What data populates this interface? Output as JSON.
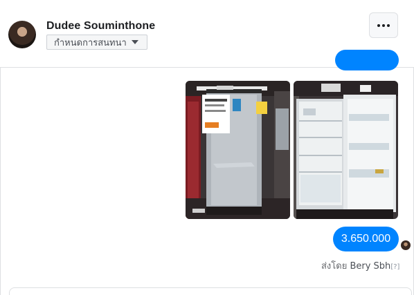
{
  "header": {
    "name": "Dudee Souminthone",
    "nickname_button": "กำหนดการสนทนา"
  },
  "messages": {
    "last_text": "3.650.000",
    "sent_by_prefix": "ส่งโดย ",
    "sent_by_name": "Bery Sbh",
    "help_mark": "[?]"
  },
  "colors": {
    "bubble": "#0084ff",
    "border": "#dddfe2"
  },
  "icons": {
    "more": "three-dots-icon",
    "caret": "caret-down-icon"
  }
}
